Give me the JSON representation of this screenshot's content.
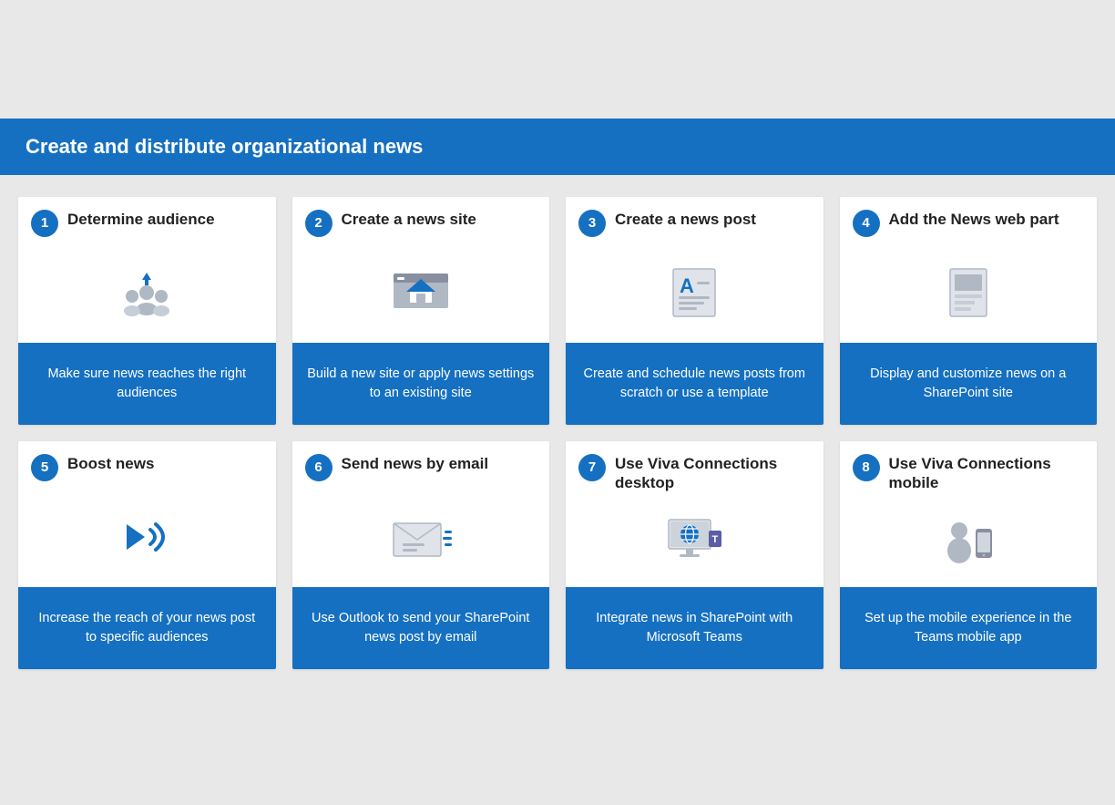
{
  "header": {
    "title": "Create and distribute organizational news"
  },
  "cards": [
    {
      "step": "1",
      "title": "Determine audience",
      "description": "Make sure news reaches the right audiences",
      "icon": "audience"
    },
    {
      "step": "2",
      "title": "Create a news site",
      "description": "Build a new site or apply news settings to an existing site",
      "icon": "site"
    },
    {
      "step": "3",
      "title": "Create a news post",
      "description": "Create and schedule news posts from scratch or use a template",
      "icon": "post"
    },
    {
      "step": "4",
      "title": "Add the News web part",
      "description": "Display and customize news on a SharePoint site",
      "icon": "webpart"
    },
    {
      "step": "5",
      "title": "Boost news",
      "description": "Increase the reach of your news post to specific audiences",
      "icon": "boost"
    },
    {
      "step": "6",
      "title": "Send news by email",
      "description": "Use Outlook to send your SharePoint news post by email",
      "icon": "email"
    },
    {
      "step": "7",
      "title": "Use Viva Connections desktop",
      "description": "Integrate news in SharePoint with Microsoft Teams",
      "icon": "desktop"
    },
    {
      "step": "8",
      "title": "Use Viva Connections mobile",
      "description": "Set up the mobile experience in the Teams mobile app",
      "icon": "mobile"
    }
  ]
}
